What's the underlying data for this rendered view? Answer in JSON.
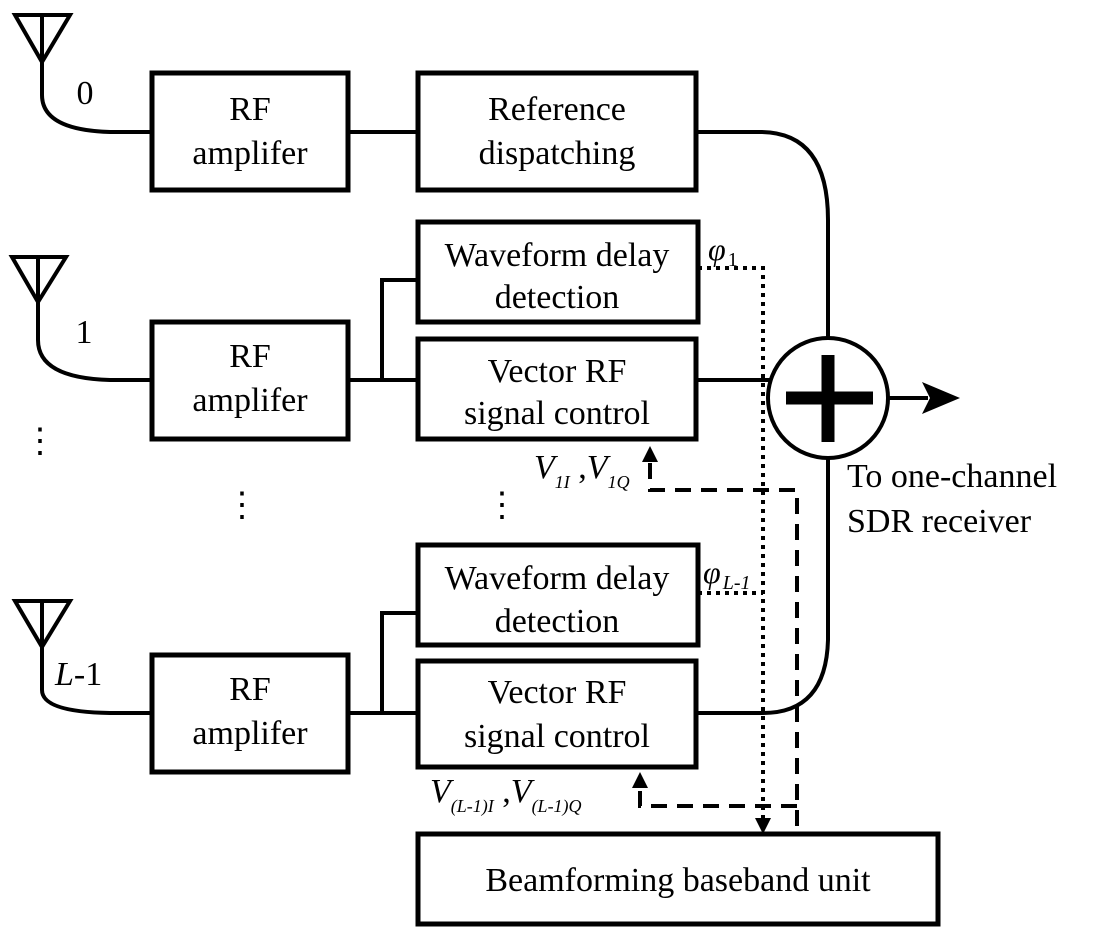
{
  "diagram": {
    "antennas": [
      {
        "label": "0"
      },
      {
        "label": "1"
      },
      {
        "label_italic": "L",
        "label_rest": "-1"
      }
    ],
    "rf_amplifier": {
      "line1": "RF",
      "line2": "amplifer"
    },
    "reference_dispatching": {
      "line1": "Reference",
      "line2": "dispatching"
    },
    "waveform_delay_detection": {
      "line1": "Waveform delay",
      "line2": "detection"
    },
    "vector_rf_signal_control": {
      "line1": "Vector RF",
      "line2": "signal control"
    },
    "beamforming_unit": {
      "label": "Beamforming baseband unit"
    },
    "phase_labels": [
      {
        "symbol": "φ",
        "sub": "1"
      },
      {
        "symbol": "φ",
        "sub": "L-1"
      }
    ],
    "control_labels": [
      {
        "v": "V",
        "sub1": "1I",
        "sep": " ,",
        "v2": "V",
        "sub2": "1Q"
      },
      {
        "v": "V",
        "sub1": "(L-1)I",
        "sep": " ,",
        "v2": "V",
        "sub2": "(L-1)Q"
      }
    ],
    "output": {
      "line1": "To one-channel",
      "line2": "SDR receiver"
    },
    "ellipsis": "⋮"
  }
}
